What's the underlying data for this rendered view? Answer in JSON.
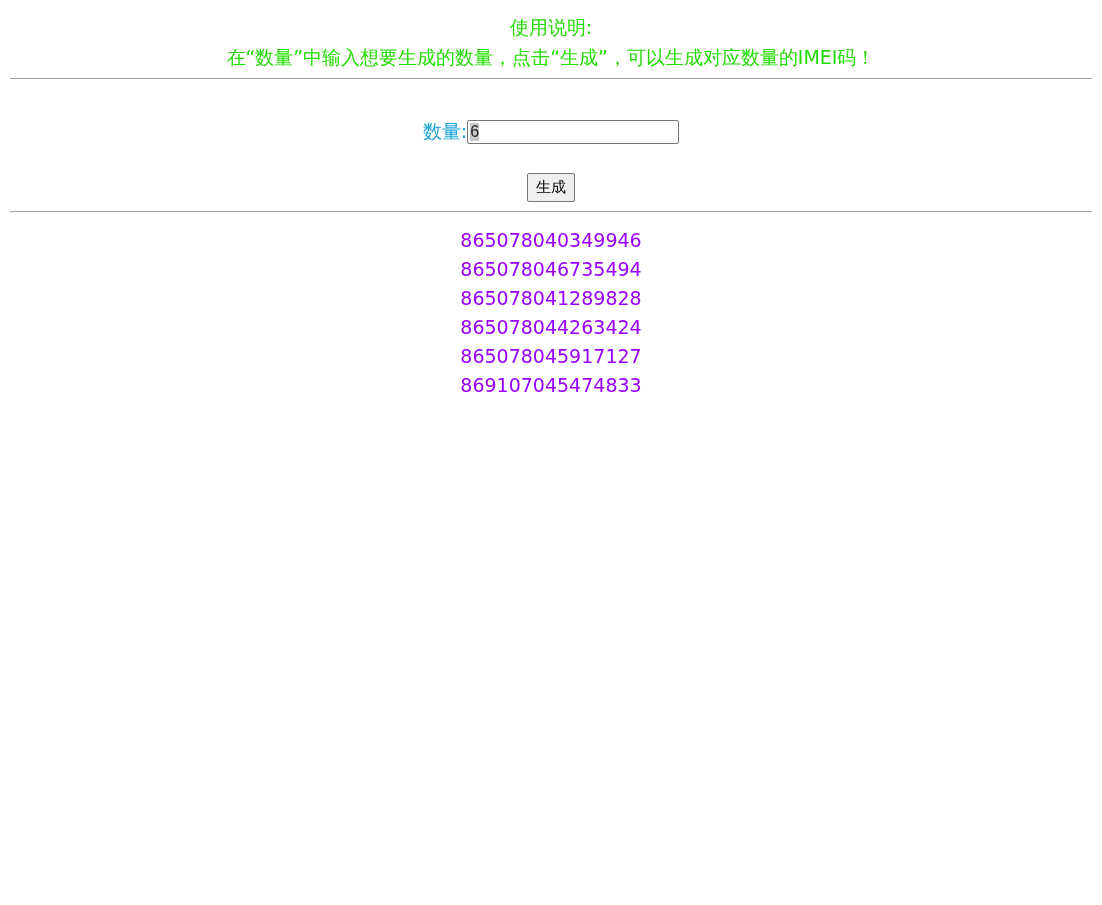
{
  "instructions": {
    "title": "使用说明:",
    "text": "在“数量”中输入想要生成的数量，点击“生成”，可以生成对应数量的IMEI码！"
  },
  "form": {
    "label": "数量:",
    "field": {
      "value": "6",
      "selected": true
    },
    "button": "生成"
  },
  "results": [
    "865078040349946",
    "865078046735494",
    "865078041289828",
    "865078044263424",
    "865078045917127",
    "869107045474833"
  ]
}
